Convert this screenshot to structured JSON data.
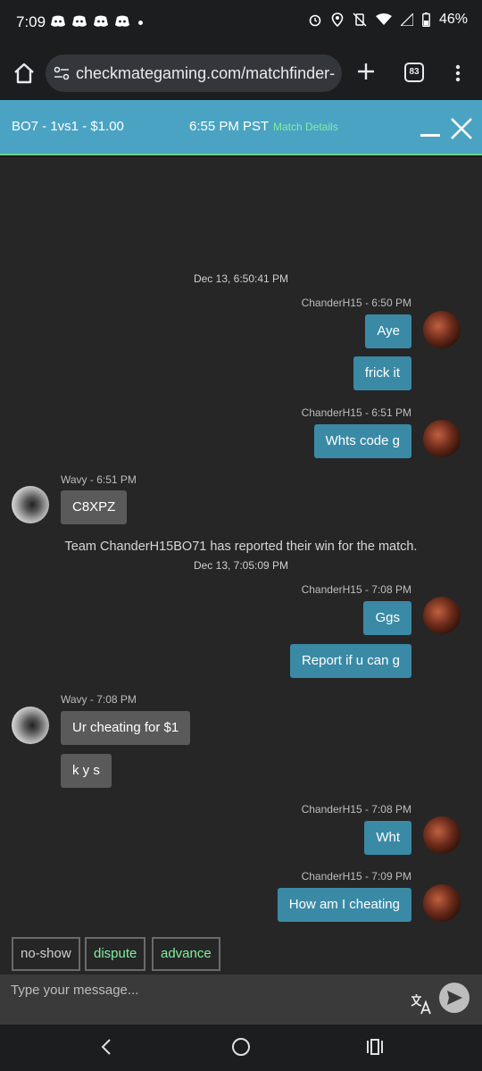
{
  "status_bar": {
    "time": "7:09",
    "battery": "46%"
  },
  "browser": {
    "url": "checkmategaming.com/matchfinder-",
    "tab_count": "83"
  },
  "match_header": {
    "title": "BO7 - 1vs1 - $1.00",
    "time": "6:55 PM PST",
    "details_link": "Match Details"
  },
  "chat": {
    "timestamps": [
      "Dec 13, 6:50:41 PM",
      "Dec 13, 7:05:09 PM"
    ],
    "system_message": "Team ChanderH15BO71 has reported their win for the match.",
    "groups": [
      {
        "sender": "ChanderH15 - 6:50 PM",
        "messages": [
          "Aye",
          "frick it"
        ]
      },
      {
        "sender": "ChanderH15 - 6:51 PM",
        "messages": [
          "Whts code g"
        ]
      },
      {
        "sender": "Wavy - 6:51 PM",
        "messages": [
          "C8XPZ"
        ]
      },
      {
        "sender": "ChanderH15 - 7:08 PM",
        "messages": [
          "Ggs",
          "Report if u can g"
        ]
      },
      {
        "sender": "Wavy - 7:08 PM",
        "messages": [
          "Ur cheating for $1",
          "k y s"
        ]
      },
      {
        "sender": "ChanderH15 - 7:08 PM",
        "messages": [
          "Wht"
        ]
      },
      {
        "sender": "ChanderH15 - 7:09 PM",
        "messages": [
          "How am I cheating"
        ]
      }
    ]
  },
  "actions": {
    "no_show": "no-show",
    "dispute": "dispute",
    "advance": "advance"
  },
  "composer": {
    "placeholder": "Type your message..."
  },
  "colors": {
    "header_blue": "#4aa3c2",
    "my_bubble": "#3a8aa6",
    "their_bubble": "#5a5a5a",
    "accent_green": "#7ff0a2"
  }
}
